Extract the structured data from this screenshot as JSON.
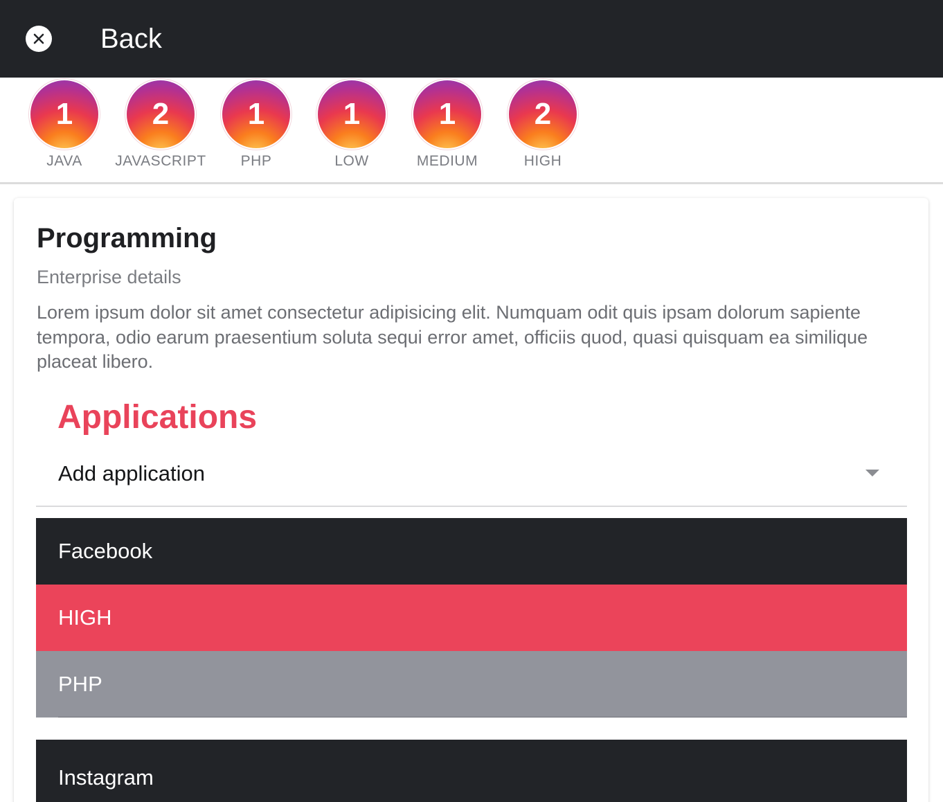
{
  "header": {
    "close_icon": "close-icon",
    "title": "Back"
  },
  "stats": [
    {
      "count": "1",
      "label": "JAVA"
    },
    {
      "count": "2",
      "label": "JAVASCRIPT"
    },
    {
      "count": "1",
      "label": "PHP"
    },
    {
      "count": "1",
      "label": "LOW"
    },
    {
      "count": "1",
      "label": "MEDIUM"
    },
    {
      "count": "2",
      "label": "HIGH"
    }
  ],
  "card": {
    "title": "Programming",
    "subtitle": "Enterprise details",
    "description": "Lorem ipsum dolor sit amet consectetur adipisicing elit. Numquam odit quis ipsam dolorum sapiente tempora, odio earum praesentium soluta sequi error amet, officiis quod, quasi quisquam ea similique placeat libero."
  },
  "applications": {
    "section_title": "Applications",
    "add_select_label": "Add application",
    "items": [
      {
        "name": "Facebook",
        "priority": "HIGH",
        "language": "PHP"
      },
      {
        "name": "Instagram"
      }
    ]
  },
  "colors": {
    "toolbar": "#222428",
    "accent": "#e9435a",
    "priority_high": "#eb445a",
    "language_row": "#92949c"
  }
}
